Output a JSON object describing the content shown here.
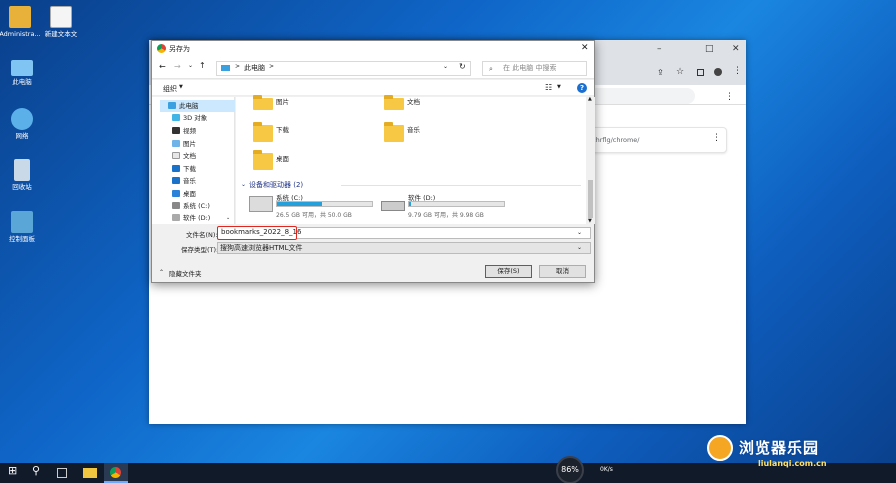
{
  "desktop": {
    "icons": [
      {
        "label": "Administra...",
        "color": "#e8b23a"
      },
      {
        "label": "新建文本文",
        "color": "#f5f5f5"
      },
      {
        "label": "此电脑",
        "color": "#7fc4f3"
      },
      {
        "label": "网络",
        "color": "#5bb0ea"
      },
      {
        "label": "回收站",
        "color": "#c9d9e8"
      },
      {
        "label": "控制面板",
        "color": "#5aa6d6"
      }
    ]
  },
  "browser": {
    "url_fragment": "chrflg/chrome/"
  },
  "dialog": {
    "title": "另存为",
    "breadcrumb": "此电脑",
    "breadcrumb_sep": ">",
    "search_placeholder": "在 此电脑 中搜索",
    "toolbar": {
      "organize": "组织"
    },
    "tree": [
      "此电脑",
      "3D 对象",
      "视频",
      "图片",
      "文档",
      "下载",
      "音乐",
      "桌面",
      "系统 (C:)",
      "软件 (D:)"
    ],
    "folders": {
      "pictures": "图片",
      "documents": "文档",
      "downloads": "下载",
      "music": "音乐",
      "desktop": "桌面"
    },
    "drives_header": "设备和驱动器 (2)",
    "drives": [
      {
        "name": "系统 (C:)",
        "free_text": "26.5 GB 可用，共 50.0 GB",
        "used_fraction": 0.47
      },
      {
        "name": "软件 (D:)",
        "free_text": "9.79 GB 可用，共 9.98 GB",
        "used_fraction": 0.02
      }
    ],
    "filename_label": "文件名(N):",
    "filename_value": "bookmarks_2022_8_16",
    "filetype_label": "保存类型(T):",
    "filetype_value": "搜狗高速浏览器HTML文件",
    "hide_folders": "隐藏文件夹",
    "save_button": "保存(S)",
    "cancel_button": "取消"
  },
  "taskbar": {
    "perf_percent": "86%",
    "net_label": "0K/s"
  },
  "watermark": {
    "brand": "浏览器乐园",
    "site": "liulanqi.com.cn"
  }
}
